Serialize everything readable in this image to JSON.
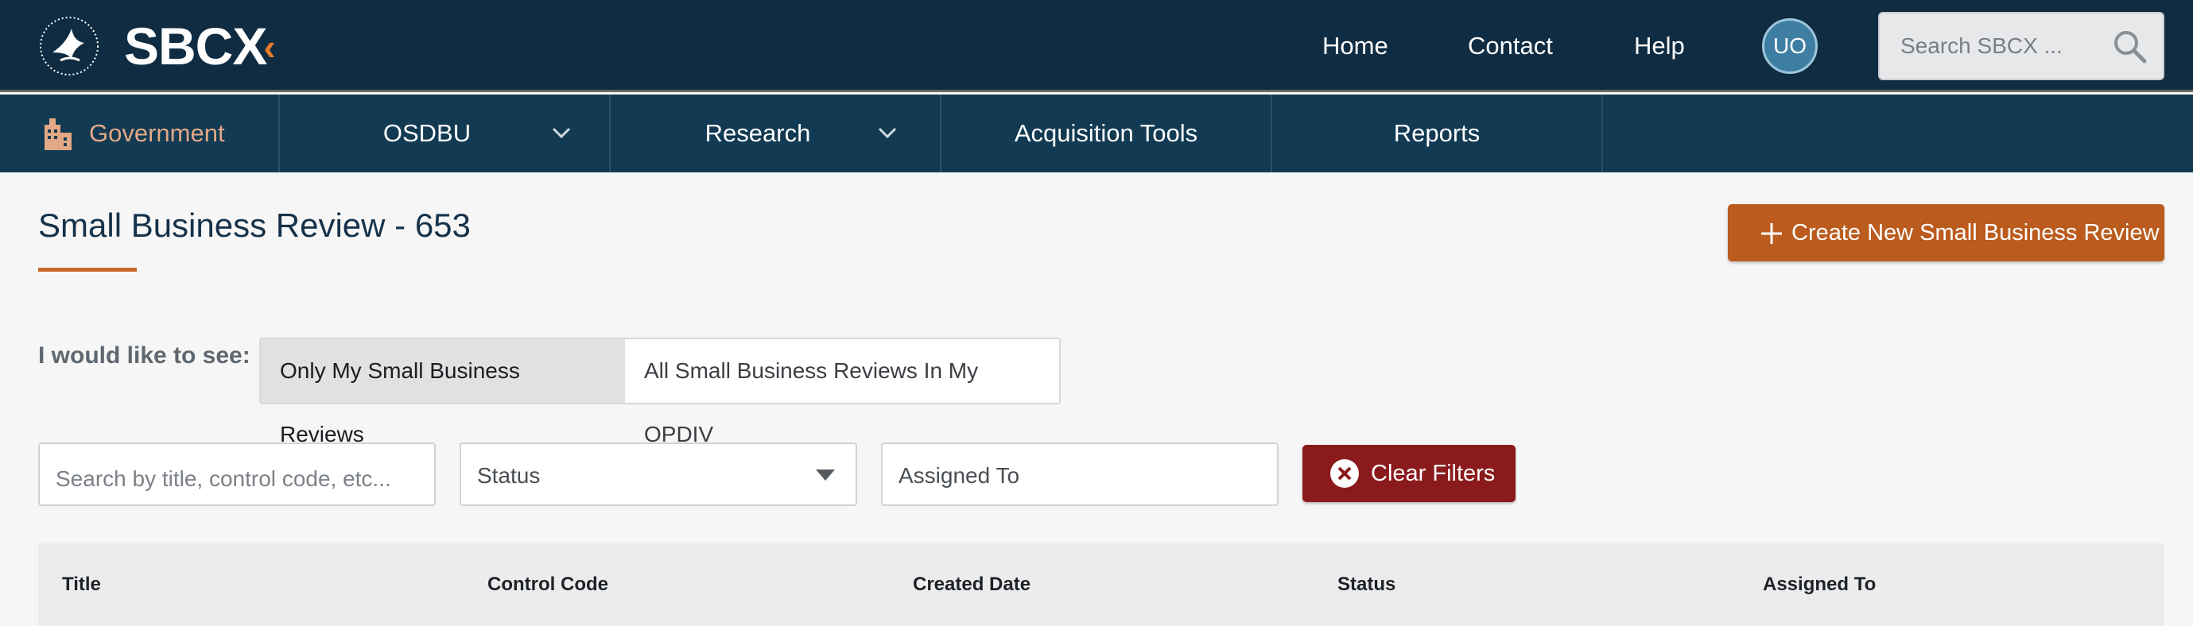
{
  "brand": {
    "name": "SBCX",
    "mark": "‹"
  },
  "topnav": {
    "home": "Home",
    "contact": "Contact",
    "help": "Help"
  },
  "user": {
    "initials": "UO"
  },
  "search": {
    "placeholder": "Search SBCX ..."
  },
  "subnav": {
    "government": "Government",
    "osdbu": "OSDBU",
    "research": "Research",
    "acquisition_tools": "Acquisition Tools",
    "reports": "Reports"
  },
  "page": {
    "title": "Small Business Review - 653",
    "create_button": "Create New Small Business Review"
  },
  "filter_scope": {
    "label": "I would like to see:",
    "options": [
      "Only My Small Business Reviews",
      "All Small Business Reviews In My OPDIV"
    ],
    "selected": "Only My Small Business Reviews"
  },
  "filters": {
    "search_placeholder": "Search by title, control code, etc...",
    "status_value": "Status",
    "assigned_to_placeholder": "Assigned To",
    "clear_button": "Clear Filters"
  },
  "table": {
    "columns": [
      "Title",
      "Control Code",
      "Created Date",
      "Status",
      "Assigned To"
    ]
  },
  "colors": {
    "header_bg": "#0f2c42",
    "subnav_bg": "#123a52",
    "primary_button": "#bb5b1d",
    "danger_button": "#8a1a1c",
    "accent": "#c8692a"
  }
}
